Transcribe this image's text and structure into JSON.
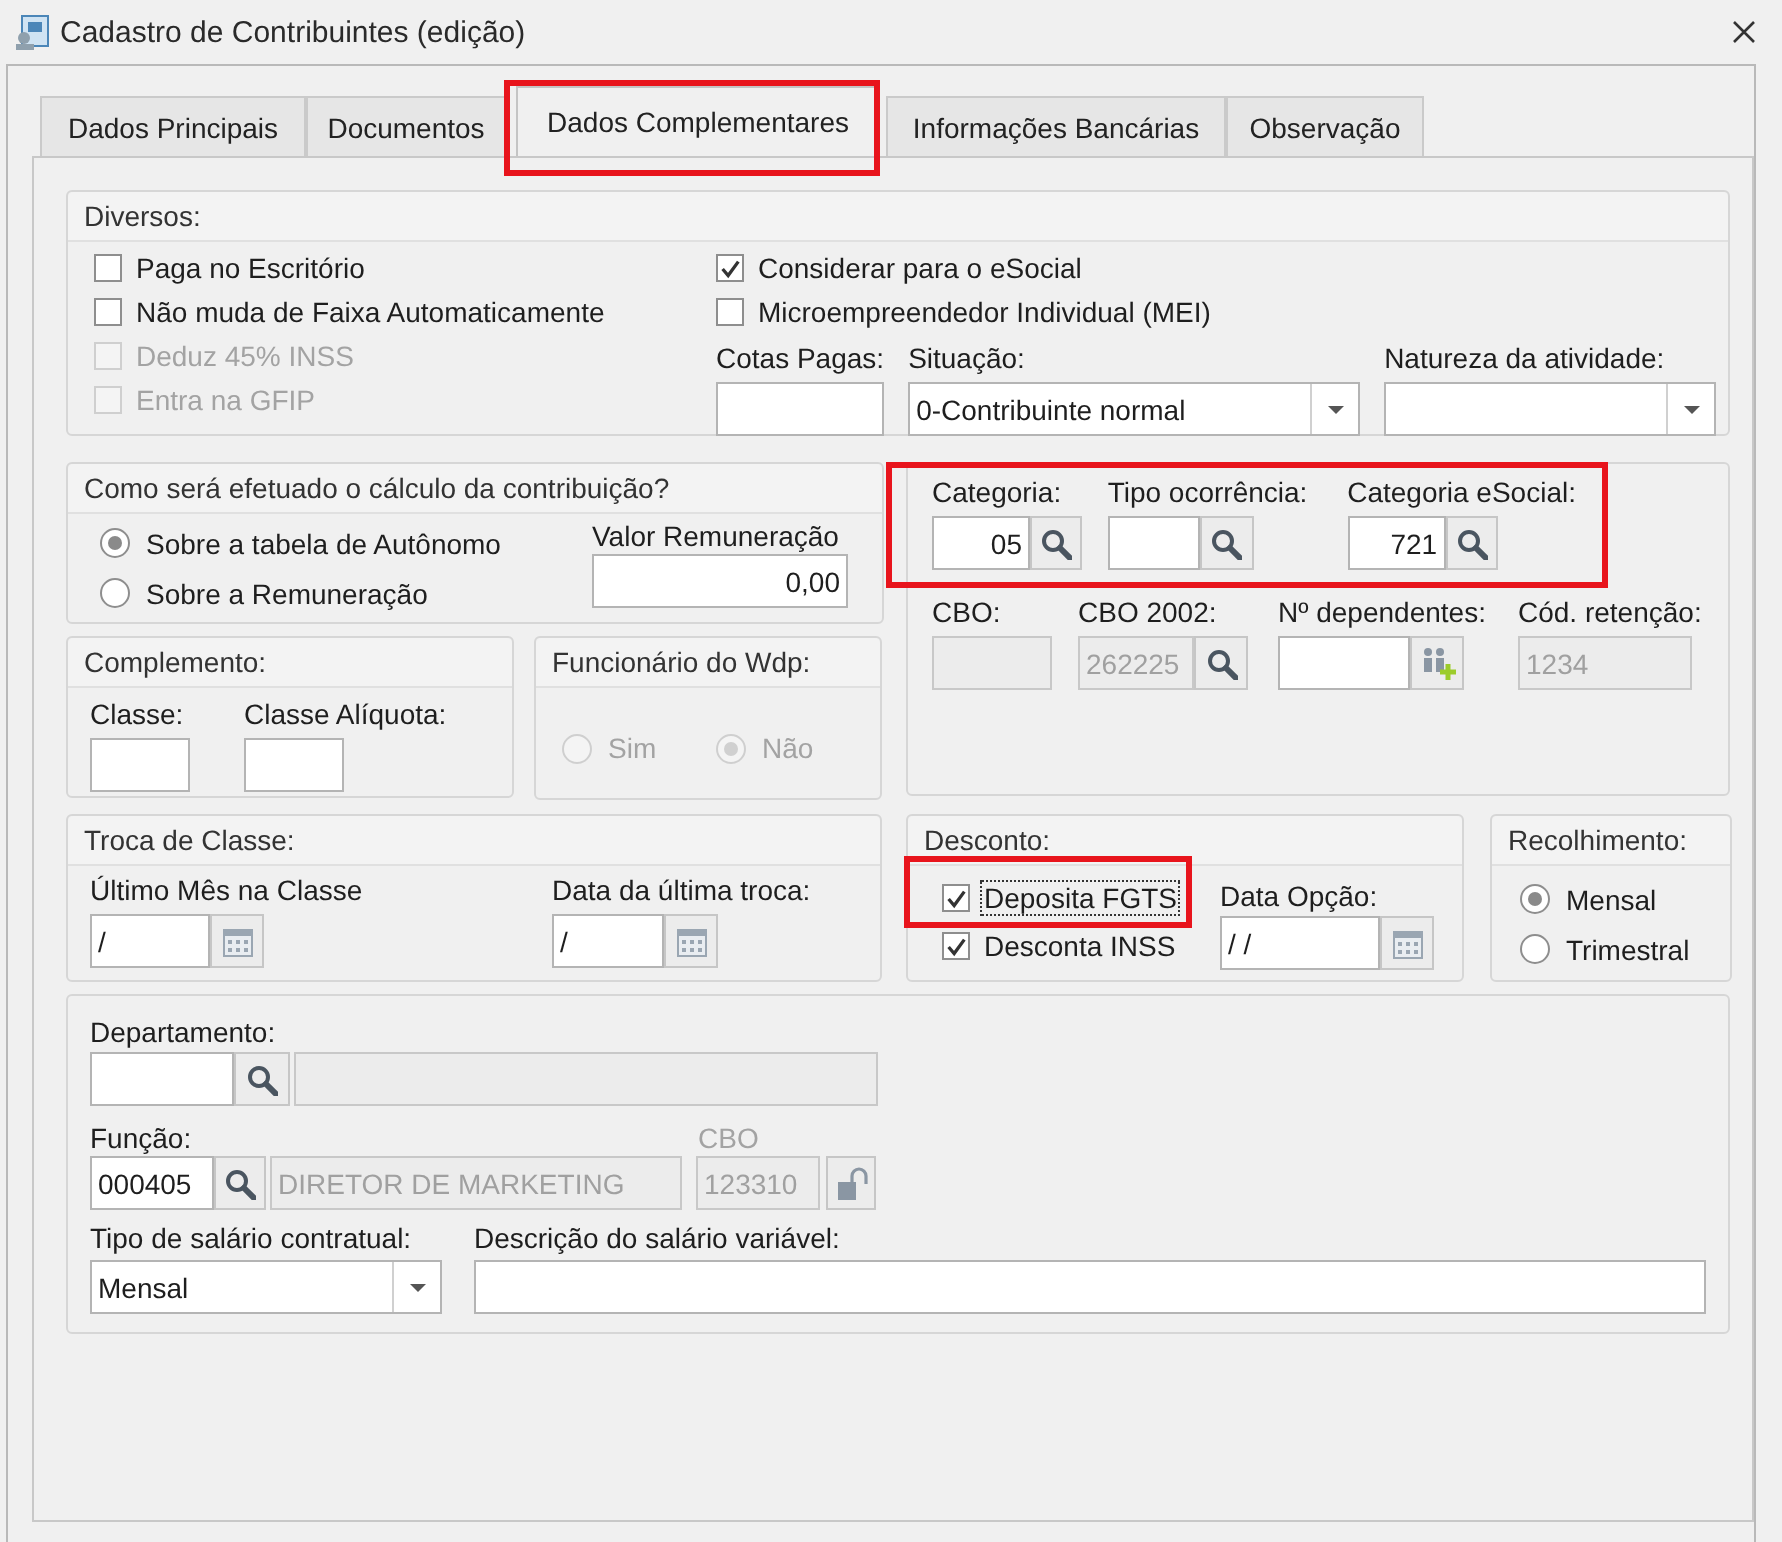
{
  "window": {
    "title": "Cadastro de Contribuintes (edição)"
  },
  "tabs": [
    {
      "label": "Dados Principais",
      "selected": false,
      "highlighted": false
    },
    {
      "label": "Documentos",
      "selected": false,
      "highlighted": false
    },
    {
      "label": "Dados Complementares",
      "selected": true,
      "highlighted": true
    },
    {
      "label": "Informações Bancárias",
      "selected": false,
      "highlighted": false
    },
    {
      "label": "Observação",
      "selected": false,
      "highlighted": false
    }
  ],
  "diversos": {
    "title": "Diversos:",
    "options_left": [
      {
        "label": "Paga no Escritório",
        "checked": false,
        "disabled": false
      },
      {
        "label": "Não muda de Faixa Automaticamente",
        "checked": false,
        "disabled": false
      },
      {
        "label": "Deduz 45% INSS",
        "checked": false,
        "disabled": true
      },
      {
        "label": "Entra na GFIP",
        "checked": false,
        "disabled": true
      }
    ],
    "options_right": [
      {
        "label": "Considerar para o eSocial",
        "checked": true,
        "disabled": false
      },
      {
        "label": "Microempreendedor Individual (MEI)",
        "checked": false,
        "disabled": false
      }
    ],
    "cotas_pagas": {
      "label": "Cotas Pagas:"
    },
    "situacao": {
      "label": "Situação:",
      "value": "0-Contribuinte normal"
    },
    "natureza": {
      "label": "Natureza da atividade:"
    }
  },
  "calculo": {
    "title": "Como será efetuado o cálculo da contribuição?",
    "options": [
      {
        "label": "Sobre a tabela de Autônomo",
        "selected": true
      },
      {
        "label": "Sobre a Remuneração",
        "selected": false
      }
    ],
    "valor_remuneracao": {
      "label": "Valor Remuneração",
      "value": "0,00"
    }
  },
  "categorias": {
    "highlighted": true,
    "fields": [
      {
        "label": "Categoria:",
        "value": "05"
      },
      {
        "label": "Tipo ocorrência:"
      },
      {
        "label": "Categoria eSocial:",
        "value": "721"
      }
    ]
  },
  "codigos": [
    {
      "kind": "plain",
      "label": "CBO:",
      "disabled": true
    },
    {
      "kind": "lookup",
      "label": "CBO 2002:",
      "value": "262225",
      "disabled": true
    },
    {
      "kind": "dependents",
      "label": "Nº dependentes:",
      "disabled": false
    },
    {
      "kind": "plain",
      "label": "Cód. retenção:",
      "value": "1234",
      "disabled": true
    }
  ],
  "complemento": {
    "title": "Complemento:",
    "fields": [
      {
        "label": "Classe:"
      },
      {
        "label": "Classe Alíquota:"
      }
    ]
  },
  "funcionario_wdp": {
    "title": "Funcionário do Wdp:",
    "disabled": true,
    "options": [
      {
        "label": "Sim",
        "selected": false
      },
      {
        "label": "Não",
        "selected": true
      }
    ]
  },
  "troca_classe": {
    "title": "Troca de Classe:",
    "fields": [
      {
        "label": "Último Mês na Classe",
        "value": "/"
      },
      {
        "label": "Data da última troca:",
        "value": "/"
      }
    ]
  },
  "desconto": {
    "title": "Desconto:",
    "options": [
      {
        "label": "Deposita FGTS",
        "checked": true,
        "focused": true,
        "highlighted": true
      },
      {
        "label": "Desconta INSS",
        "checked": true,
        "focused": false,
        "highlighted": false
      }
    ],
    "data_opcao": {
      "label": "Data Opção:",
      "value": "/ /"
    }
  },
  "recolhimento": {
    "title": "Recolhimento:",
    "options": [
      {
        "label": "Mensal",
        "selected": true
      },
      {
        "label": "Trimestral",
        "selected": false
      }
    ]
  },
  "departamento": {
    "label": "Departamento:"
  },
  "funcao": {
    "label": "Função:",
    "code": "000405",
    "name": "DIRETOR DE MARKETING",
    "cbo_label": "CBO",
    "cbo": "123310"
  },
  "tipo_salario": {
    "label": "Tipo de salário contratual:",
    "value": "Mensal"
  },
  "descricao_salario": {
    "label": "Descrição do salário variável:"
  }
}
